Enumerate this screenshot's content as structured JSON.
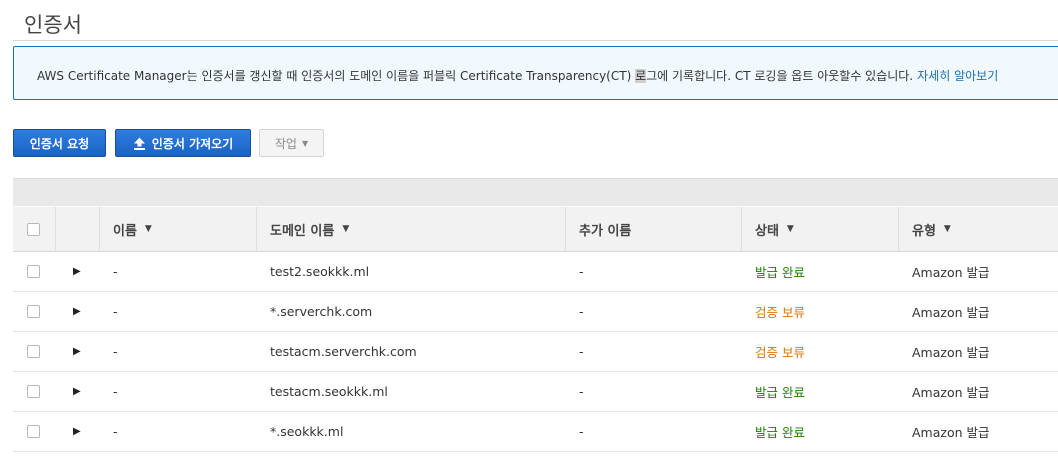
{
  "page": {
    "title": "인증서"
  },
  "info": {
    "text_before": "AWS Certificate Manager는 인증서를 갱신할 때 인증서의 도메인 이름을 퍼블릭 Certificate Transparency(CT) ",
    "text_highlight": "로",
    "text_after": "그에 기록합니다. CT 로깅을 옵트 아웃할수 있습니다.",
    "link": "자세히 알아보기"
  },
  "toolbar": {
    "request_label": "인증서 요청",
    "import_label": "인증서 가져오기",
    "actions_label": "작업"
  },
  "table": {
    "headers": {
      "name": "이름",
      "domain": "도메인 이름",
      "additional": "추가 이름",
      "status": "상태",
      "type": "유형"
    },
    "rows": [
      {
        "name": "-",
        "domain": "test2.seokkk.ml",
        "additional": "-",
        "status": "발급 완료",
        "status_kind": "issued",
        "type": "Amazon 발급"
      },
      {
        "name": "-",
        "domain": "*.serverchk.com",
        "additional": "-",
        "status": "검증 보류",
        "status_kind": "pending",
        "type": "Amazon 발급"
      },
      {
        "name": "-",
        "domain": "testacm.serverchk.com",
        "additional": "-",
        "status": "검증 보류",
        "status_kind": "pending",
        "type": "Amazon 발급"
      },
      {
        "name": "-",
        "domain": "testacm.seokkk.ml",
        "additional": "-",
        "status": "발급 완료",
        "status_kind": "issued",
        "type": "Amazon 발급"
      },
      {
        "name": "-",
        "domain": "*.seokkk.ml",
        "additional": "-",
        "status": "발급 완료",
        "status_kind": "issued",
        "type": "Amazon 발급"
      }
    ]
  },
  "colors": {
    "primary": "#1e6bd0",
    "issued": "#1d8102",
    "pending": "#d97706",
    "link": "#1b6fb3"
  },
  "icons": {
    "import": "upload-icon",
    "sort": "caret-down-icon",
    "expand": "caret-right-icon"
  }
}
